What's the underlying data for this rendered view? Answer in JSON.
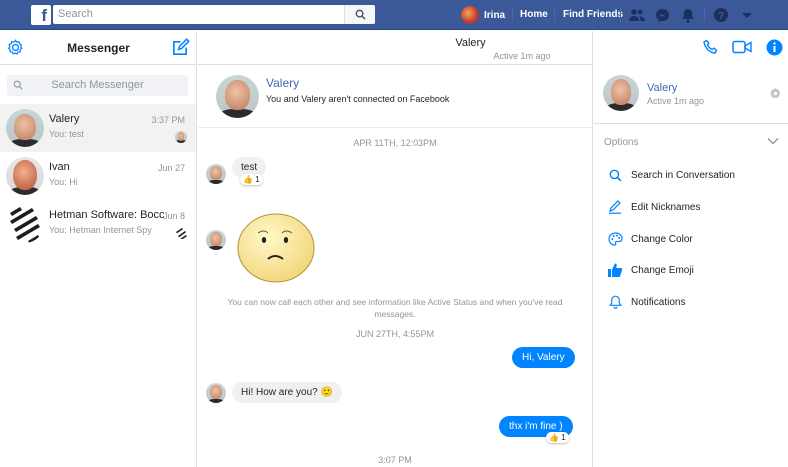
{
  "topbar": {
    "search_placeholder": "Search",
    "user_name": "Irina",
    "home": "Home",
    "find_friends": "Find Friends"
  },
  "sidebar": {
    "title": "Messenger",
    "search_placeholder": "Search Messenger",
    "conversations": [
      {
        "name": "Valery",
        "snippet": "You: test",
        "time": "3:37 PM"
      },
      {
        "name": "Ivan",
        "snippet": "You: Hi",
        "time": "Jun 27"
      },
      {
        "name": "Hetman Software: Восстан...",
        "snippet": "You: Hetman Internet Spy",
        "time": "Jun 8"
      }
    ]
  },
  "chat": {
    "name": "Valery",
    "status": "Active 1m ago",
    "intro_name": "Valery",
    "intro_sub": "You and Valery aren't connected on Facebook",
    "ts1": "APR 11TH, 12:03PM",
    "msg1": "test",
    "msg1_reaction_count": "1",
    "info": "You can now call each other and see information like Active Status and when you've read messages.",
    "ts2": "JUN 27TH, 4:55PM",
    "out1": "Hi, Valery",
    "in2": "Hi! How are you?",
    "out2": "thx i'm fine )",
    "out2_reaction_count": "1",
    "ts3": "3:07 PM"
  },
  "details": {
    "name": "Valery",
    "status": "Active 1m ago",
    "options_label": "Options",
    "options": [
      {
        "label": "Search in Conversation",
        "icon": "search-icon"
      },
      {
        "label": "Edit Nicknames",
        "icon": "pencil-icon"
      },
      {
        "label": "Change Color",
        "icon": "palette-icon"
      },
      {
        "label": "Change Emoji",
        "icon": "thumbs-up-icon"
      },
      {
        "label": "Notifications",
        "icon": "bell-icon"
      }
    ]
  },
  "colors": {
    "brand": "#3b5998",
    "accent": "#0084ff",
    "link": "#4267b2"
  }
}
